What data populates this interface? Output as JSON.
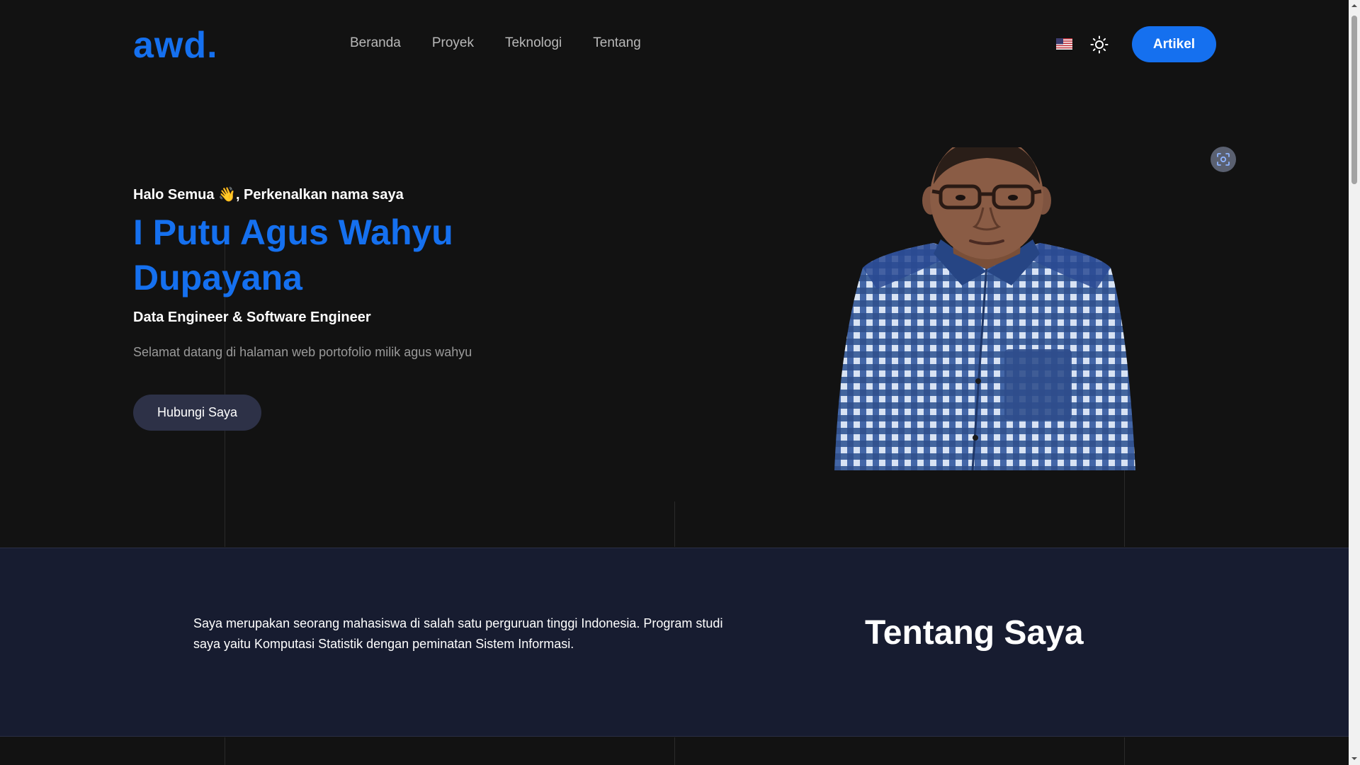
{
  "header": {
    "logo": "awd.",
    "nav": [
      {
        "label": "Beranda"
      },
      {
        "label": "Proyek"
      },
      {
        "label": "Teknologi"
      },
      {
        "label": "Tentang"
      }
    ],
    "language_icon": "us-flag-icon",
    "theme_icon": "sun-icon",
    "cta_label": "Artikel"
  },
  "hero": {
    "greeting": "Halo Semua 👋, Perkenalkan nama saya",
    "name": "I Putu Agus Wahyu Dupayana",
    "role": "Data Engineer & Software Engineer",
    "welcome": "Selamat datang di halaman web portofolio milik agus wahyu",
    "contact_label": "Hubungi Saya",
    "scan_icon": "scan-icon",
    "photo_icon": "profile-photo"
  },
  "about": {
    "text": "Saya merupakan seorang mahasiswa di salah satu perguruan tinggi Indonesia. Program studi saya yaitu Komputasi Statistik dengan peminatan Sistem Informasi.",
    "title": "Tentang Saya"
  },
  "colors": {
    "background": "#121212",
    "accent": "#1570ef",
    "about_bg": "#171c30",
    "secondary_button": "#2d3147"
  }
}
